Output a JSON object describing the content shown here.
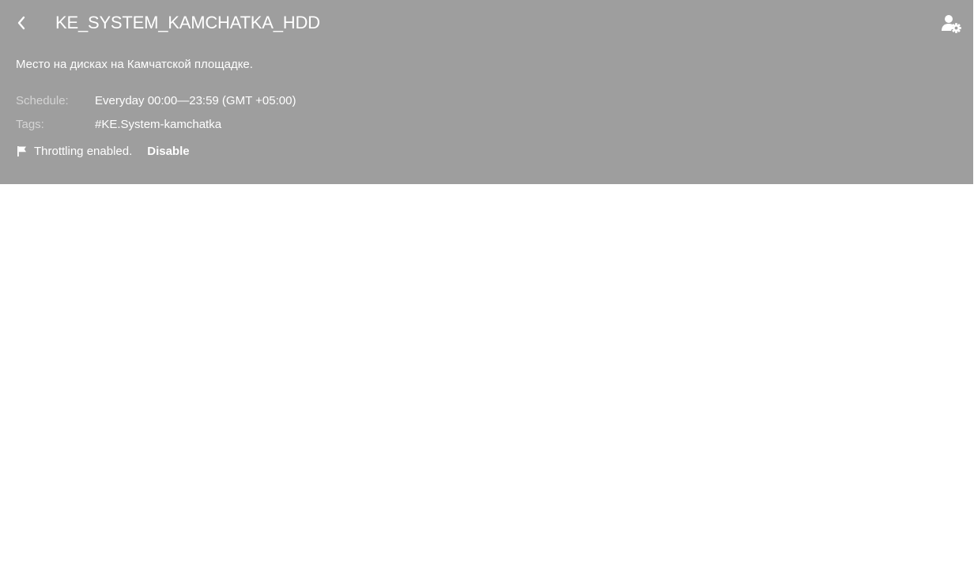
{
  "header": {
    "title": "KE_SYSTEM_KAMCHATKA_HDD",
    "back_icon": "chevron-left-icon",
    "settings_icon": "user-settings-icon",
    "background_color": "#9e9e9e",
    "text_color": "#ffffff"
  },
  "description": "Место на дисках на Камчатской площадке.",
  "schedule": {
    "label": "Schedule:",
    "value": "Everyday 00:00—23:59 (GMT +05:00)"
  },
  "tags": {
    "label": "Tags:",
    "value": "#KE.System-kamchatka"
  },
  "throttling": {
    "icon": "flag-icon",
    "text": "Throttling enabled.",
    "action_label": "Disable"
  }
}
